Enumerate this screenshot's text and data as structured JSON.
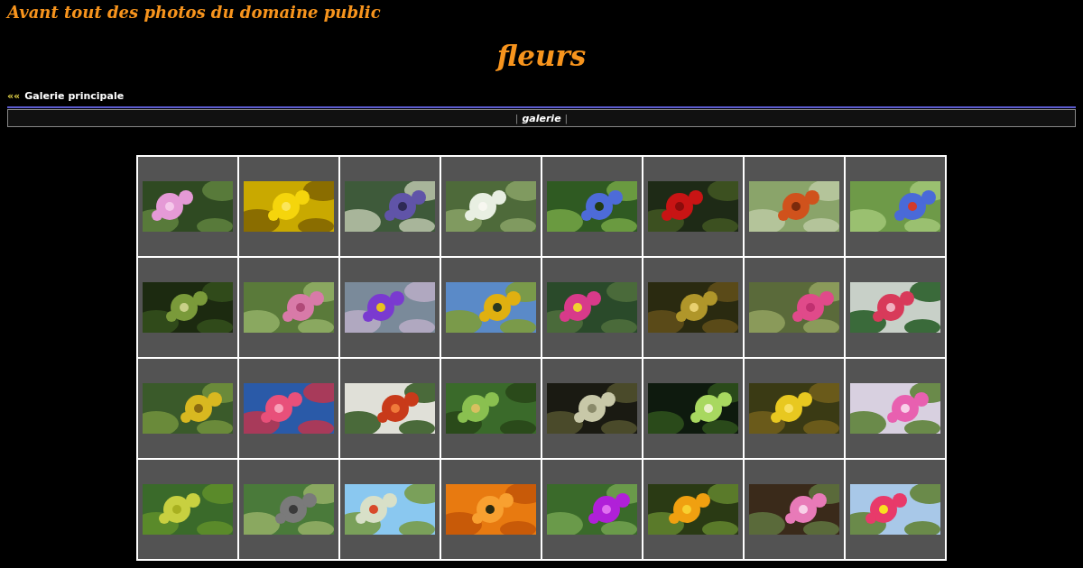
{
  "site_title": "Avant tout des photos du domaine public",
  "page_title": "fleurs",
  "back_link": {
    "arrows": "««",
    "label": "Galerie principale"
  },
  "nav_bar": {
    "separator_left": "|",
    "label": "galerie",
    "separator_right": "|"
  }
}
